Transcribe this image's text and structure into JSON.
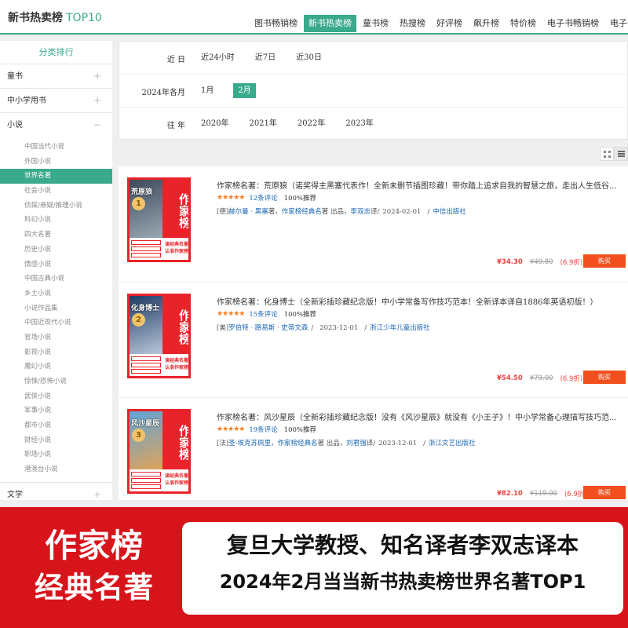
{
  "header": {
    "brand": "新书热卖榜",
    "brand_accent": "TOP10",
    "tabs": [
      {
        "label": "图书畅销榜",
        "active": false
      },
      {
        "label": "新书热卖榜",
        "active": true
      },
      {
        "label": "童书榜",
        "active": false
      },
      {
        "label": "热搜榜",
        "active": false
      },
      {
        "label": "好评榜",
        "active": false
      },
      {
        "label": "飙升榜",
        "active": false
      },
      {
        "label": "特价榜",
        "active": false
      },
      {
        "label": "电子书畅销榜",
        "active": false
      },
      {
        "label": "电子书",
        "active": false
      }
    ]
  },
  "sidebar": {
    "title": "分类排行",
    "categories": [
      {
        "label": "童书",
        "sign": "+"
      },
      {
        "label": "中小学用书",
        "sign": "+"
      },
      {
        "label": "小说",
        "sign": "−"
      },
      {
        "label": "文学",
        "sign": "+"
      }
    ],
    "subcategories": [
      "中国当代小说",
      "外国小说",
      "世界名著",
      "社会小说",
      "侦探/悬疑/推理小说",
      "科幻小说",
      "四大名著",
      "历史小说",
      "情感小说",
      "中国古典小说",
      "乡土小说",
      "小说作品集",
      "中国近现代小说",
      "官场小说",
      "影视小说",
      "魔幻小说",
      "惊悚/恐怖小说",
      "武侠小说",
      "军事小说",
      "都市小说",
      "财经小说",
      "职场小说",
      "港澳台小说"
    ],
    "active_subcategory": "世界名著"
  },
  "filter": {
    "row1": {
      "label": "近 日",
      "options": [
        "近24小时",
        "近7日",
        "近30日"
      ]
    },
    "row2": {
      "label": "2024年各月",
      "options": [
        "1月",
        "2月"
      ],
      "active": "2月"
    },
    "row3": {
      "label": "往 年",
      "options": [
        "2020年",
        "2021年",
        "2022年",
        "2023年"
      ]
    }
  },
  "view_toggle": {
    "grid_icon": "grid-icon",
    "list_icon": "list-icon",
    "selected": "list"
  },
  "products": [
    {
      "rank": "1",
      "cover_title": "荒原狼",
      "cover_band": "作家榜",
      "cover_slogan": "读经典名著 认准作家榜",
      "title": "作家榜名著：荒原狼（诺奖得主黑塞代表作！全新未删节插图珍藏！带你踏上追求自我的智慧之旅，走出人生低谷...",
      "stars": "★★★★★",
      "comments": "12条评论",
      "recommend": "100%推荐",
      "nationality": "[德]",
      "author": "赫尔曼 · 黑塞",
      "author_suffix": "著，",
      "publisher_brand": "作家榜经典名",
      "brand_suffix": "著 出品，",
      "translator": "李双志",
      "translator_suffix": "译/",
      "date": "2024-02-01",
      "press": "中信出版社",
      "price": "¥34.30",
      "orig_price": "¥49.80",
      "discount": "(6.9折)",
      "buy": "购买",
      "cover_color_top": "#3e4a5a",
      "cover_color_bottom": "#9aa7b3"
    },
    {
      "rank": "2",
      "cover_title": "化身博士",
      "cover_band": "作家榜",
      "cover_slogan": "读经典名著 认准作家榜",
      "title": "作家榜名著：化身博士（全新彩插珍藏纪念版！中小学常备写作技巧范本！全新译本译自1886年英语初版！）",
      "stars": "★★★★★",
      "comments": "15条评论",
      "recommend": "100%推荐",
      "nationality": "[美]",
      "author": "罗伯特 · 路易斯 · 史蒂文森",
      "author_suffix": "",
      "publisher_brand": "",
      "brand_suffix": "",
      "translator": "",
      "translator_suffix": "",
      "date": "2023-12-01",
      "press": "浙江少年儿童出版社",
      "price": "¥54.50",
      "orig_price": "¥79.00",
      "discount": "(6.9折)",
      "buy": "购买",
      "cover_color_top": "#1f3b66",
      "cover_color_bottom": "#b9c7d9"
    },
    {
      "rank": "3",
      "cover_title": "风沙星辰",
      "cover_band": "作家榜",
      "cover_slogan": "读经典名著 认准作家榜",
      "title": "作家榜名著：风沙星辰（全新彩插珍藏纪念版！没有《风沙星辰》就没有《小王子》！中小学常备心理描写技巧范...",
      "stars": "★★★★★",
      "comments": "19条评论",
      "recommend": "100%推荐",
      "nationality": "[法]",
      "author": "圣-埃克苏佩里",
      "author_suffix": "，",
      "publisher_brand": "作家榜经典名",
      "brand_suffix": "著 出品，",
      "translator": "刘君强",
      "translator_suffix": "译/",
      "date": "2023-12-01",
      "press": "浙江文艺出版社",
      "price": "¥82.10",
      "orig_price": "¥119.00",
      "discount": "(6.9折)",
      "buy": "购买",
      "cover_color_top": "#5ea5d8",
      "cover_color_bottom": "#e0a35a"
    }
  ],
  "banner": {
    "left_line1": "作家榜",
    "left_line2": "经典名著",
    "right_line1": "复旦大学教授、知名译者李双志译本",
    "right_line2": "2024年2月当当新书热卖榜世界名著TOP1"
  }
}
